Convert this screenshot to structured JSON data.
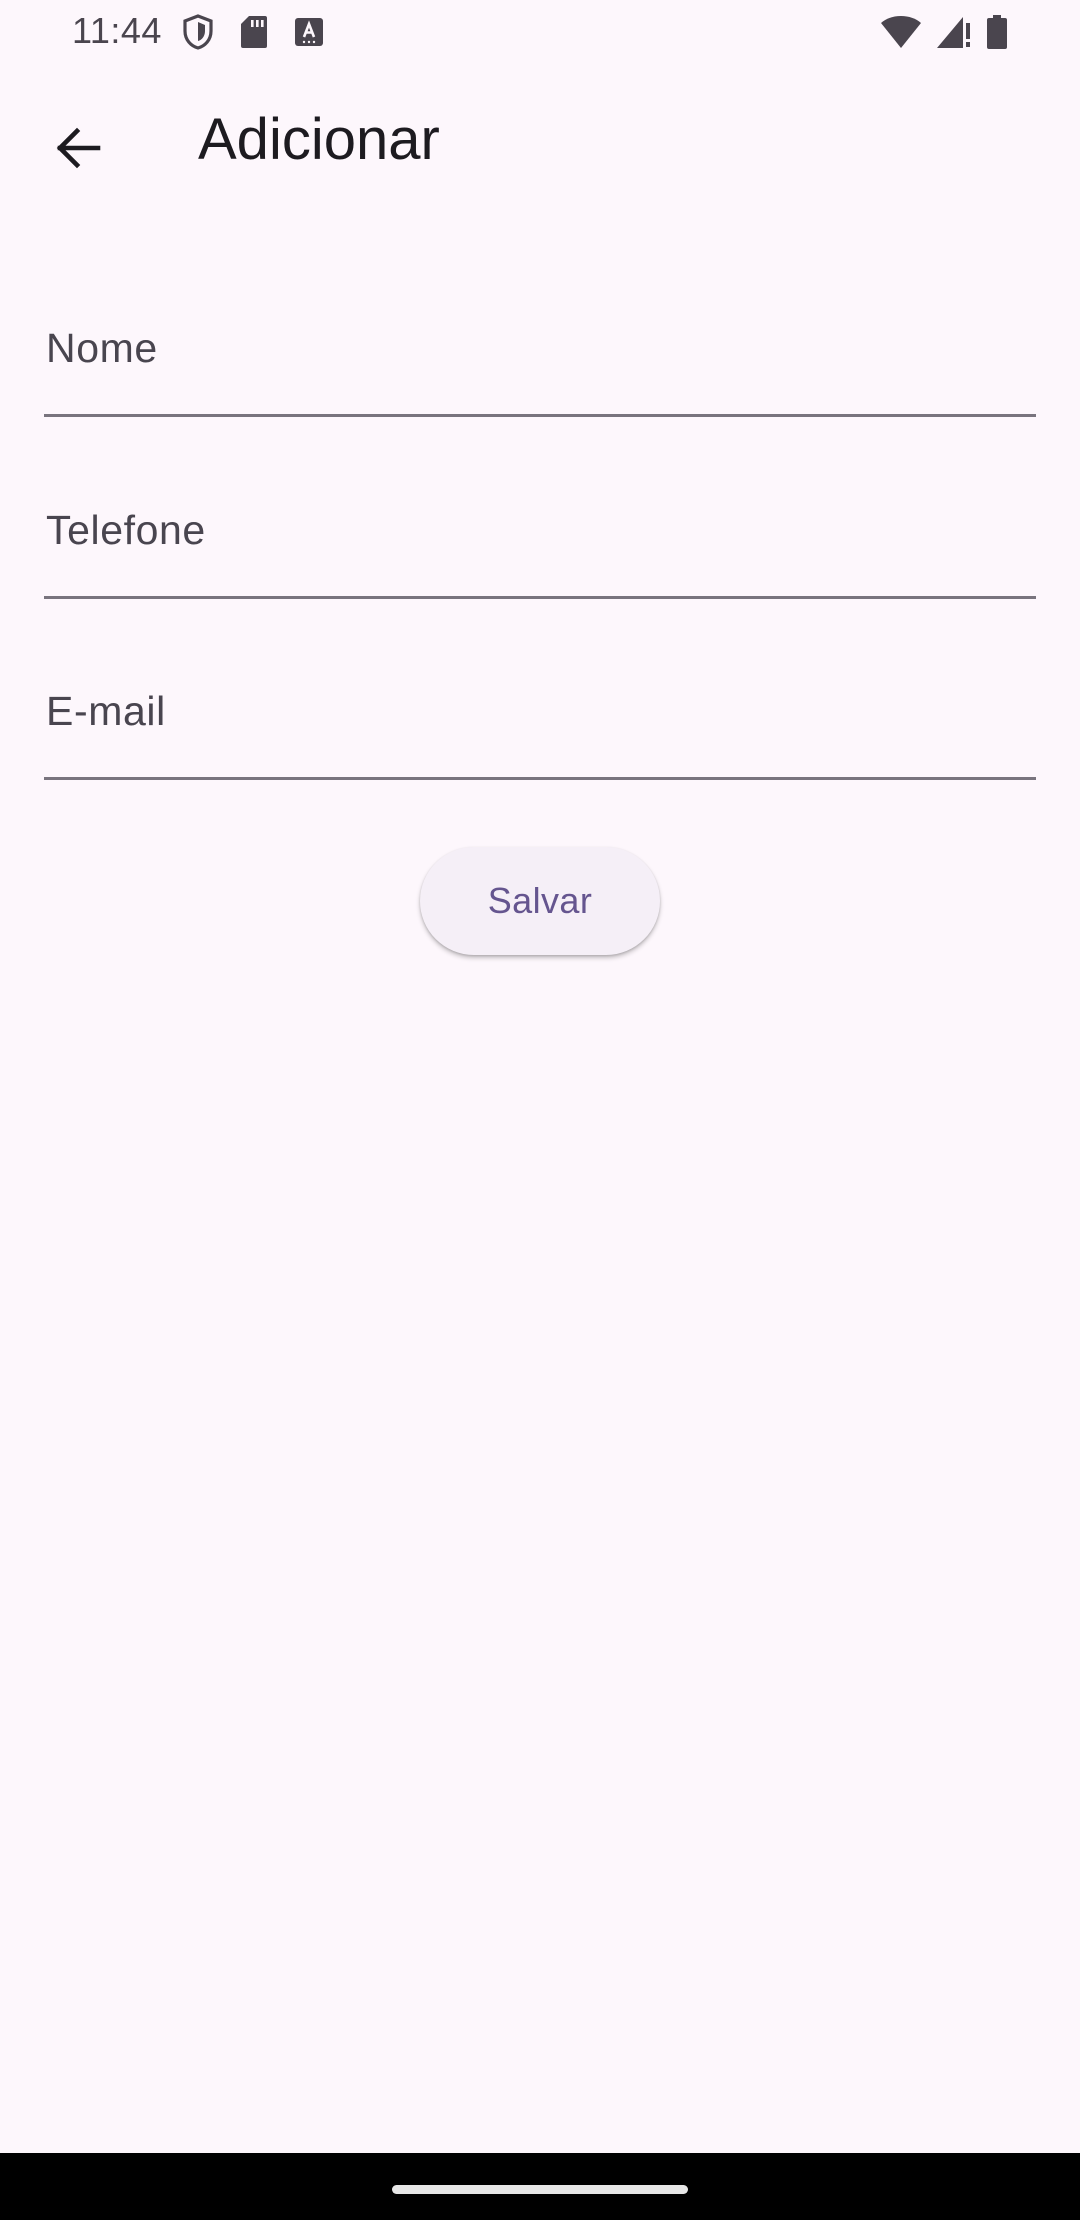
{
  "status_bar": {
    "time": "11:44",
    "icons": [
      "shield-icon",
      "sd-card-icon",
      "keyboard-a-icon",
      "wifi-icon",
      "signal-alert-icon",
      "battery-icon"
    ]
  },
  "app_bar": {
    "back_icon": "arrow-back-icon",
    "title": "Adicionar"
  },
  "form": {
    "fields": [
      {
        "label": "Nome",
        "value": ""
      },
      {
        "label": "Telefone",
        "value": ""
      },
      {
        "label": "E-mail",
        "value": ""
      }
    ],
    "save_label": "Salvar"
  },
  "colors": {
    "background": "#fdf7fc",
    "accent": "#65558f",
    "button_surface": "#f5eff7",
    "underline": "#79747e"
  }
}
